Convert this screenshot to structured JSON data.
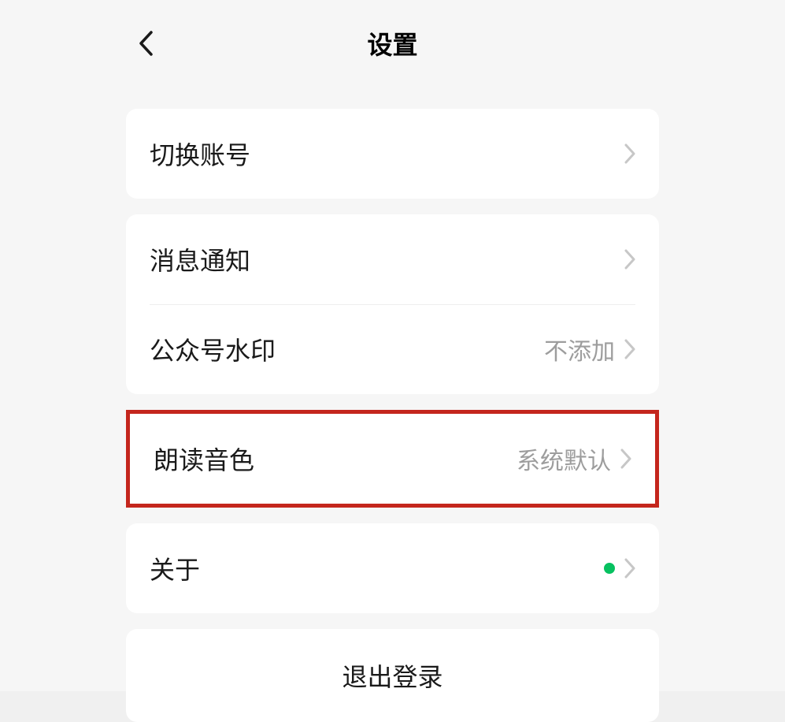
{
  "header": {
    "title": "设置"
  },
  "groups": [
    {
      "rows": [
        {
          "label": "切换账号",
          "value": "",
          "badge": false
        }
      ],
      "highlighted": false
    },
    {
      "rows": [
        {
          "label": "消息通知",
          "value": "",
          "badge": false
        },
        {
          "label": "公众号水印",
          "value": "不添加",
          "badge": false
        }
      ],
      "highlighted": false
    },
    {
      "rows": [
        {
          "label": "朗读音色",
          "value": "系统默认",
          "badge": false
        }
      ],
      "highlighted": true
    },
    {
      "rows": [
        {
          "label": "关于",
          "value": "",
          "badge": true
        }
      ],
      "highlighted": false
    }
  ],
  "logout": {
    "label": "退出登录"
  }
}
